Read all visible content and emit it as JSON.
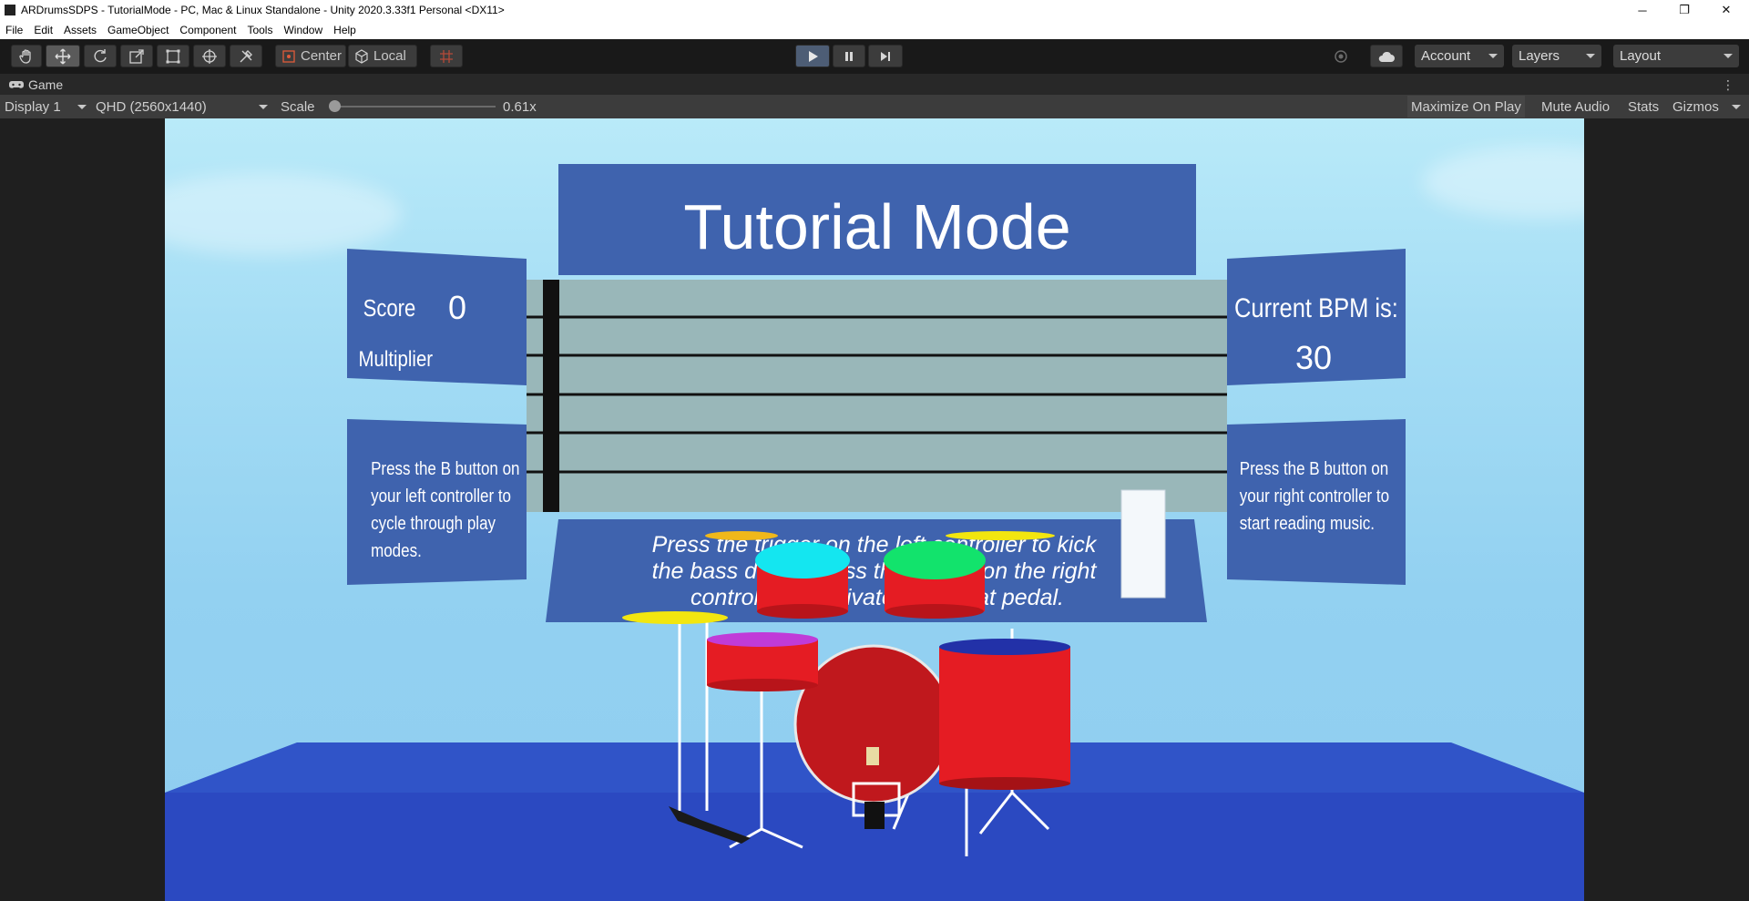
{
  "window": {
    "title": "ARDrumsSDPS - TutorialMode - PC, Mac & Linux Standalone - Unity 2020.3.33f1 Personal <DX11>",
    "controls": [
      "─",
      "❐",
      "✕"
    ]
  },
  "menu": {
    "items": [
      "File",
      "Edit",
      "Assets",
      "GameObject",
      "Component",
      "Tools",
      "Window",
      "Help"
    ]
  },
  "toolbar": {
    "pivot_label": "Center",
    "space_label": "Local",
    "account_label": "Account",
    "layers_label": "Layers",
    "layout_label": "Layout"
  },
  "game_tab": {
    "label": "Game"
  },
  "game_bar": {
    "display": "Display 1",
    "resolution": "QHD (2560x1440)",
    "scale_label": "Scale",
    "scale_value": "0.61x",
    "scale_fraction": 0.02,
    "maximize_label": "Maximize On Play",
    "mute_label": "Mute Audio",
    "stats_label": "Stats",
    "gizmos_label": "Gizmos"
  },
  "scene": {
    "title": "Tutorial Mode",
    "score_label": "Score",
    "score_value": "0",
    "multiplier_label": "Multiplier",
    "bpm_label": "Current BPM is:",
    "bpm_value": "30",
    "left_help": "Press the B button on your left controller to cycle through play modes.",
    "right_help": "Press the B button on your right controller to start reading music.",
    "instruction": "Press the trigger on the left controller to kick the bass drum. Press the trigger on the right controller to activate the hi-hat pedal.",
    "colors": {
      "panel": "#3f63ae",
      "staff": "#99b7b9",
      "drum_red": "#e51c23",
      "tom_cyan": "#14e6f0",
      "tom_green": "#12e36c",
      "cymbal": "#f2e60f"
    }
  }
}
